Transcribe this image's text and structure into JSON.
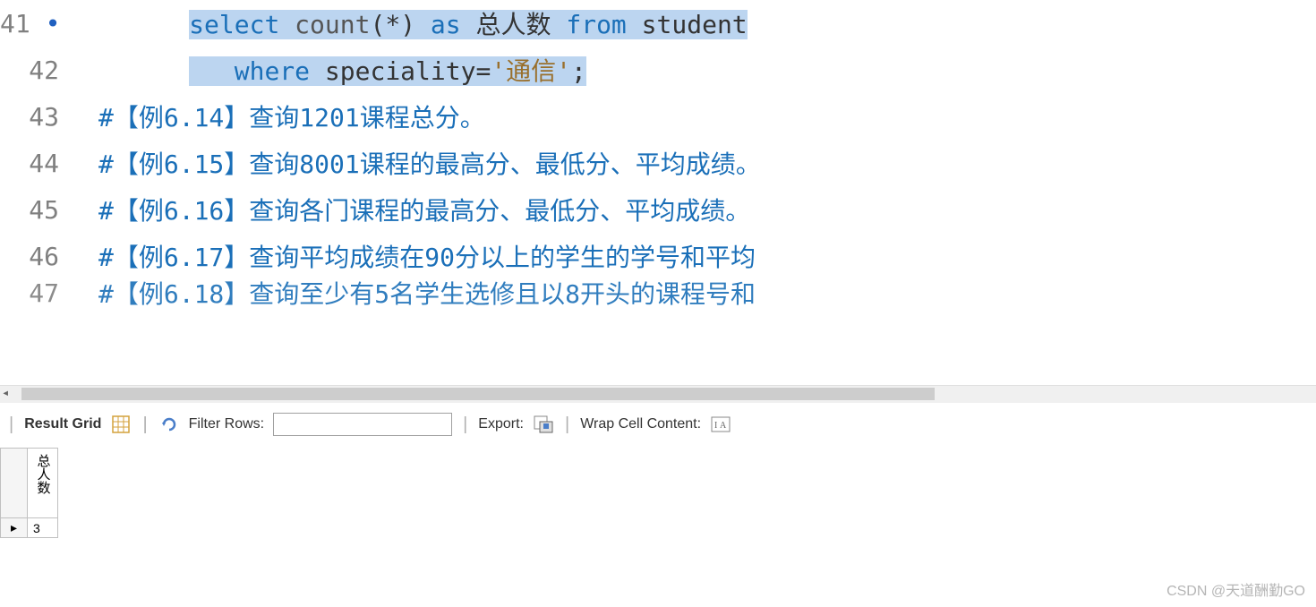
{
  "editor": {
    "lines": [
      {
        "num": "41",
        "active": true
      },
      {
        "num": "42",
        "active": false
      },
      {
        "num": "43",
        "active": false
      },
      {
        "num": "44",
        "active": false
      },
      {
        "num": "45",
        "active": false
      },
      {
        "num": "46",
        "active": false
      },
      {
        "num": "47",
        "active": false
      }
    ],
    "tokens": {
      "l41_select": "select",
      "l41_count": "count",
      "l41_paren_open": "(",
      "l41_star": "*",
      "l41_paren_close": ")",
      "l41_as": "as",
      "l41_alias": "总人数",
      "l41_from": "from",
      "l41_table": "student",
      "l42_where": "where",
      "l42_col": "speciality",
      "l42_eq": "=",
      "l42_str": "'通信'",
      "l42_semi": ";",
      "l43_comment": "#【例6.14】查询1201课程总分。",
      "l44_comment": "#【例6.15】查询8001课程的最高分、最低分、平均成绩。",
      "l45_comment": "#【例6.16】查询各门课程的最高分、最低分、平均成绩。",
      "l46_comment": "#【例6.17】查询平均成绩在90分以上的学生的学号和平均",
      "l47_comment": "#【例6.18】查询至少有5名学生选修且以8开头的课程号和"
    }
  },
  "toolbar": {
    "result_grid": "Result Grid",
    "filter_rows": "Filter Rows:",
    "filter_placeholder": "",
    "export": "Export:",
    "wrap_cell": "Wrap Cell Content:"
  },
  "result": {
    "column_header": "总人数",
    "row_indicator": "▸",
    "value": "3"
  },
  "watermark": "CSDN @天道酬勤GO"
}
